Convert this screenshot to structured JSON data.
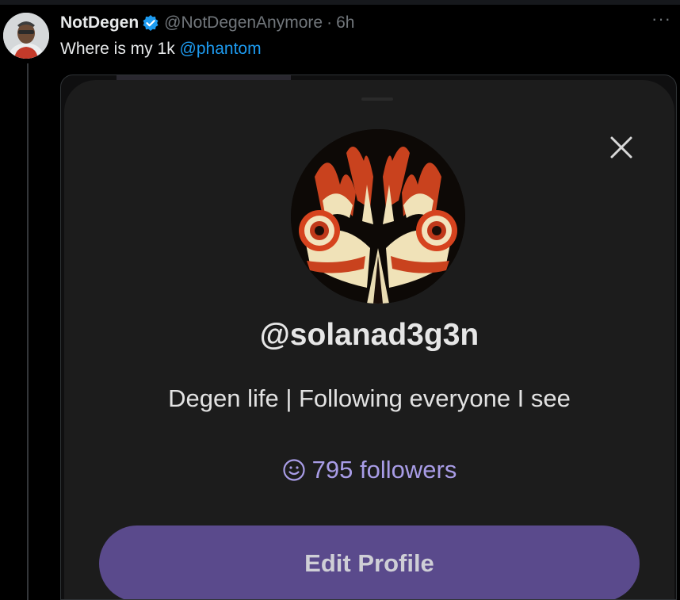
{
  "tweet": {
    "display_name": "NotDegen",
    "handle": "@NotDegenAnymore",
    "separator": "·",
    "time": "6h",
    "more_label": "···",
    "text": "Where is my 1k ",
    "mention": "@phantom"
  },
  "profile_card": {
    "username": "@solanad3g3n",
    "bio": "Degen life | Following everyone I see",
    "followers": "795 followers",
    "edit_button_label": "Edit Profile"
  },
  "colors": {
    "background": "#000000",
    "mention_blue": "#1d9bf0",
    "verified_blue": "#1d9bf0",
    "followers_purple": "#a89ce6",
    "button_purple": "#5a4a8c",
    "sheet_bg": "#1c1c1c"
  },
  "icons": [
    "verified-badge-icon",
    "more-options-icon",
    "close-icon",
    "smiley-icon"
  ]
}
